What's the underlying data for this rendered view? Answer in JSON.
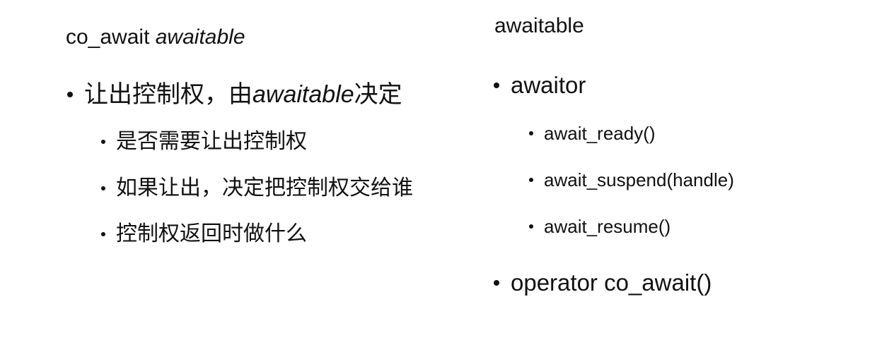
{
  "left_column": {
    "heading": {
      "prefix": "co_await",
      "italic": "awaitable"
    },
    "main_bullet": {
      "before": "让出控制权，由",
      "emphasis": "awaitable",
      "after": "决定"
    },
    "sub_bullets": [
      "是否需要让出控制权",
      "如果让出，决定把控制权交给谁",
      "控制权返回时做什么"
    ]
  },
  "right_column": {
    "heading": "awaitable",
    "bullets": [
      {
        "label": "awaitor",
        "children": [
          "await_ready()",
          "await_suspend(handle)",
          "await_resume()"
        ]
      },
      {
        "label": "operator co_await()"
      }
    ]
  }
}
